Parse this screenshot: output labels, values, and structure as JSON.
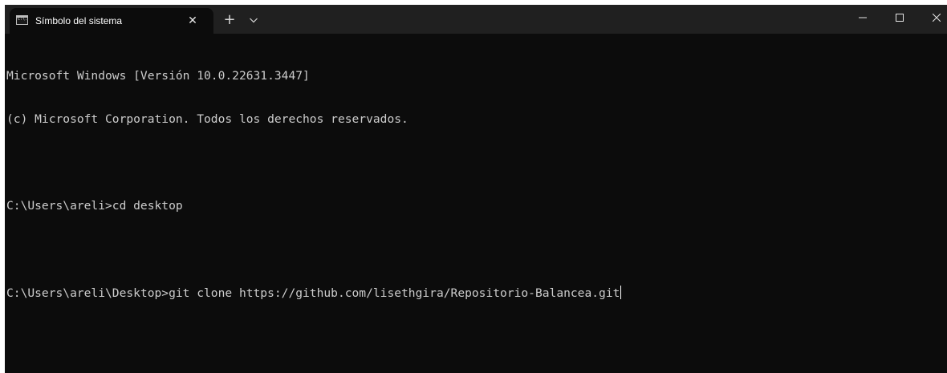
{
  "window": {
    "tab_title": "Símbolo del sistema",
    "tab_icon": "cmd-icon",
    "tab_close_icon": "close-icon",
    "new_tab_icon": "plus-icon",
    "dropdown_icon": "chevron-down-icon",
    "controls": [
      "minimize-icon",
      "maximize-icon",
      "close-icon"
    ]
  },
  "terminal": {
    "lines": [
      "Microsoft Windows [Versión 10.0.22631.3447]",
      "(c) Microsoft Corporation. Todos los derechos reservados.",
      "",
      "C:\\Users\\areli>cd desktop",
      "",
      "C:\\Users\\areli\\Desktop>git clone https://github.com/lisethgira/Repositorio-Balancea.git"
    ]
  },
  "colors": {
    "terminal_background": "#0c0c0c",
    "titlebar_background": "#202020",
    "text": "#cccccc"
  }
}
